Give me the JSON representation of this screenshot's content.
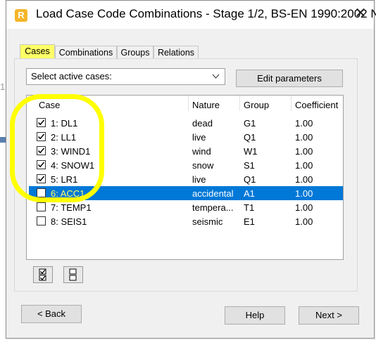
{
  "window": {
    "title": "Load Case Code Combinations - Stage 1/2, BS-EN 1990:2002 N...",
    "icon": "R",
    "close": "✕"
  },
  "tabs": [
    {
      "label": "Cases",
      "active": true
    },
    {
      "label": "Combinations",
      "active": false
    },
    {
      "label": "Groups",
      "active": false
    },
    {
      "label": "Relations",
      "active": false
    }
  ],
  "filter": {
    "selected": "Select active cases:",
    "edit_button": "Edit parameters"
  },
  "table": {
    "headers": {
      "case": "Case",
      "nature": "Nature",
      "group": "Group",
      "coefficient": "Coefficient"
    },
    "rows": [
      {
        "case": "1: DL1",
        "nature": "dead",
        "group": "G1",
        "coefficient": "1.00",
        "checked": true,
        "selected": false
      },
      {
        "case": "2: LL1",
        "nature": "live",
        "group": "Q1",
        "coefficient": "1.00",
        "checked": true,
        "selected": false
      },
      {
        "case": "3: WIND1",
        "nature": "wind",
        "group": "W1",
        "coefficient": "1.00",
        "checked": true,
        "selected": false
      },
      {
        "case": "4: SNOW1",
        "nature": "snow",
        "group": "S1",
        "coefficient": "1.00",
        "checked": true,
        "selected": false
      },
      {
        "case": "5: LR1",
        "nature": "live",
        "group": "Q1",
        "coefficient": "1.00",
        "checked": true,
        "selected": false
      },
      {
        "case": "6: ACC1",
        "nature": "accidental",
        "group": "A1",
        "coefficient": "1.00",
        "checked": false,
        "selected": true
      },
      {
        "case": "7: TEMP1",
        "nature": "tempera...",
        "group": "T1",
        "coefficient": "1.00",
        "checked": false,
        "selected": false
      },
      {
        "case": "8: SEIS1",
        "nature": "seismic",
        "group": "E1",
        "coefficient": "1.00",
        "checked": false,
        "selected": false
      }
    ]
  },
  "tools": {
    "select_all_icon": "check-all-icon",
    "deselect_all_icon": "uncheck-all-icon"
  },
  "footer": {
    "back": "< Back",
    "help": "Help",
    "next": "Next >"
  },
  "colors": {
    "highlight": "#ffff00",
    "selection": "#0078d7"
  }
}
